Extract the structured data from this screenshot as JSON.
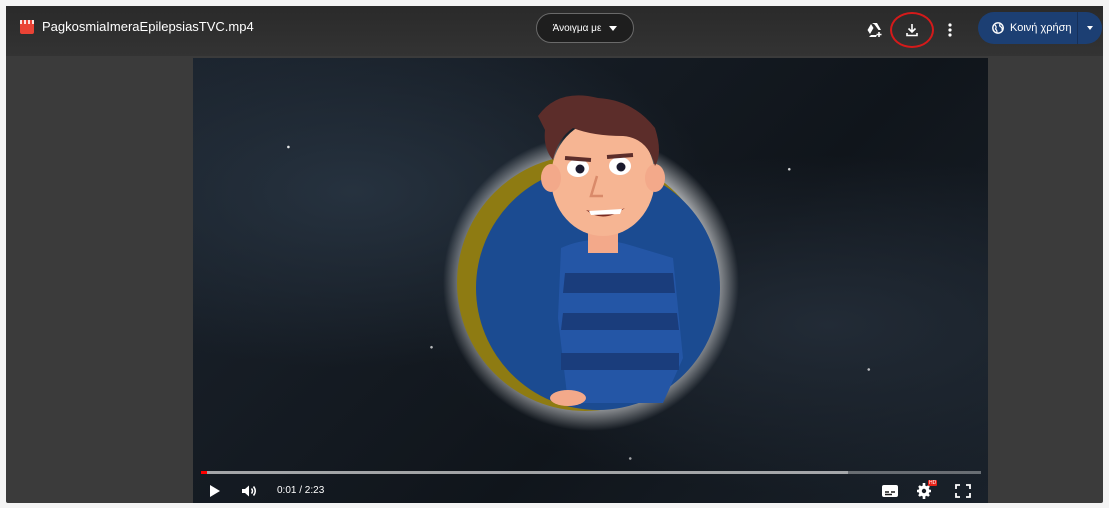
{
  "file": {
    "name": "PagkosmiaImeraEpilepsiasTVC.mp4",
    "icon": "video-file-icon",
    "icon_color": "#ea4335"
  },
  "toolbar": {
    "open_with_label": "Άνοιγμα με",
    "share_label": "Κοινή χρήση",
    "add_to_drive_icon": "add-to-drive-icon",
    "download_icon": "download-icon",
    "more_icon": "more-vert-icon",
    "share_icon": "globe-icon",
    "share_color": "#1c3f73",
    "highlight_color": "#d51a1a"
  },
  "player": {
    "time": "0:01 / 2:23",
    "progress_fraction": 0.0073,
    "buffered_fraction": 0.83,
    "hd_badge": "HD"
  }
}
